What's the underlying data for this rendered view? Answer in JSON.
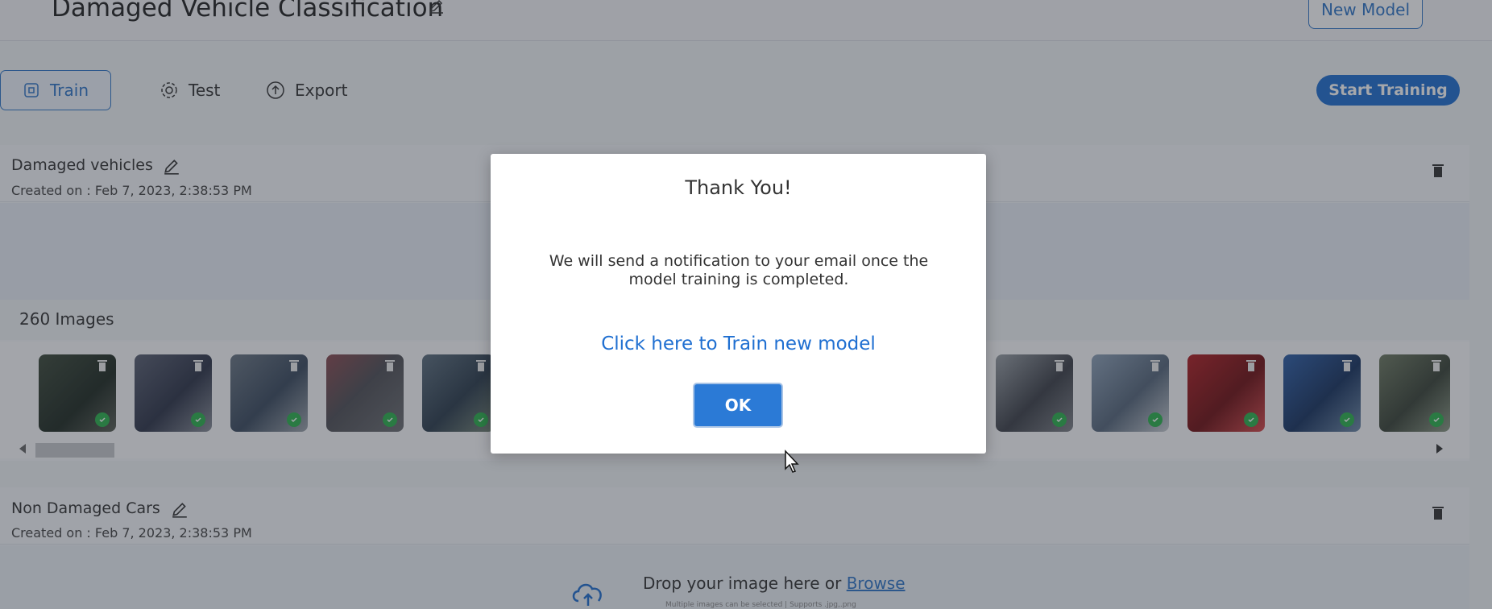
{
  "header": {
    "title": "Damaged Vehicle Classification",
    "new_model_label": "New Model"
  },
  "tabs": [
    {
      "label": "Train"
    },
    {
      "label": "Test"
    },
    {
      "label": "Export"
    }
  ],
  "start_training_label": "Start Training",
  "labels": [
    {
      "name": "Damaged vehicles",
      "created": "Created on : Feb 7, 2023, 2:38:53 PM",
      "image_count": "260 Images"
    },
    {
      "name": "Non Damaged Cars",
      "created": "Created on : Feb 7, 2023, 2:38:53 PM"
    }
  ],
  "drop_zone": {
    "text": "Drop your image here or ",
    "browse_label": "Browse",
    "subtext": "Multiple images can be selected | Supports .jpg,.png"
  },
  "modal": {
    "title": "Thank You!",
    "message": "We will send a notification to your email once the model training is completed.",
    "link_label": "Click here to Train new model",
    "ok_label": "OK"
  },
  "colors": {
    "accent": "#2f76c9",
    "primary_button": "#1f6fd1",
    "check_green": "#2bb24c"
  }
}
